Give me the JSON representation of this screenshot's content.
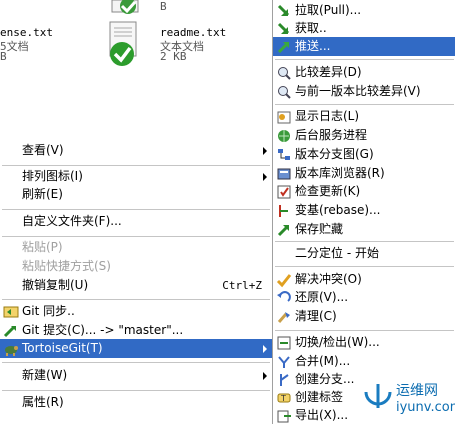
{
  "files": [
    {
      "name": "ense.txt",
      "type": "5文档",
      "size": "B"
    },
    {
      "name": "readme.txt",
      "type": "文本文档",
      "size": "2 KB"
    }
  ],
  "context_menu": {
    "view": "查看(V)",
    "arrange": "排列图标(I)",
    "refresh": "刷新(E)",
    "customize": "自定义文件夹(F)...",
    "paste": "粘贴(P)",
    "paste_shortcut": "粘贴快捷方式(S)",
    "undo": "撤销复制(U)",
    "undo_shortcut": "Ctrl+Z",
    "git_sync": "Git 同步..",
    "git_commit": "Git 提交(C)... -> \"master\"...",
    "tortoise": "TortoiseGit(T)",
    "new": "新建(W)",
    "properties": "属性(R)"
  },
  "submenu": {
    "pull": "拉取(Pull)...",
    "fetch": "获取..",
    "push": "推送...",
    "diff": "比较差异(D)",
    "diff_prev": "与前一版本比较差异(V)",
    "log": "显示日志(L)",
    "daemon": "后台服务进程",
    "revgraph": "版本分支图(G)",
    "repobrowser": "版本库浏览器(R)",
    "check": "检查更新(K)",
    "rebase": "变基(rebase)...",
    "stash": "保存贮藏",
    "bisect": "二分定位 - 开始",
    "resolve": "解决冲突(O)",
    "revert": "还原(V)...",
    "cleanup": "清理(C)",
    "switch": "切换/检出(W)...",
    "merge": "合并(M)...",
    "branch": "创建分支...",
    "tag": "创建标签",
    "export": "导出(X)..."
  },
  "watermark": {
    "cn": "运维网",
    "en": "iyunv.com"
  },
  "colors": {
    "highlight": "#316ac5",
    "disabled": "#a0a0a0"
  }
}
